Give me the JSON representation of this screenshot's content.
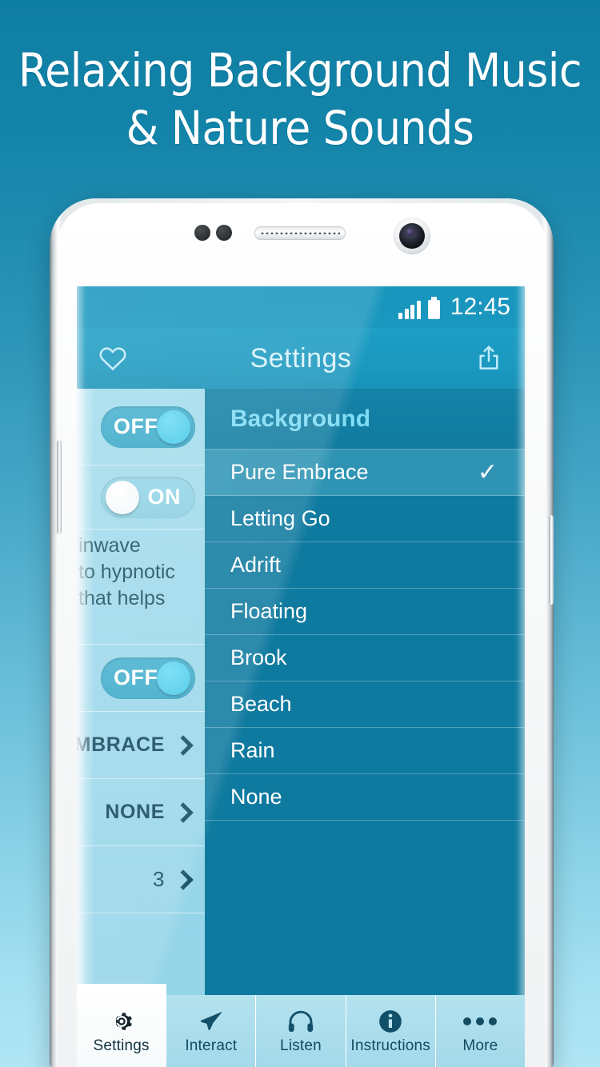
{
  "promo": {
    "headline_line1": "Relaxing Background Music",
    "headline_line2": "& Nature Sounds"
  },
  "statusbar": {
    "time": "12:45",
    "signal_icon": "signal-bars-icon",
    "battery_icon": "battery-full-icon"
  },
  "appbar": {
    "title": "Settings",
    "left_icon": "heart-icon",
    "right_icon": "share-icon"
  },
  "settings_panel": {
    "rows": [
      {
        "type": "toggle",
        "state": "OFF"
      },
      {
        "type": "toggle",
        "state": "ON"
      },
      {
        "type": "text",
        "lines": [
          "inwave",
          "to hypnotic",
          "that helps"
        ]
      },
      {
        "type": "toggle",
        "state": "OFF"
      },
      {
        "type": "value",
        "value": "MBRACE",
        "chevron": "chevron-right-icon"
      },
      {
        "type": "value",
        "value": "NONE",
        "chevron": "chevron-right-icon"
      },
      {
        "type": "value",
        "value": "3",
        "chevron": "chevron-right-icon"
      },
      {
        "type": "empty"
      }
    ]
  },
  "background_list": {
    "header": "Background",
    "selected": "Pure Embrace",
    "check_icon": "checkmark-icon",
    "items": [
      "Pure Embrace",
      "Letting Go",
      "Adrift",
      "Floating",
      "Brook",
      "Beach",
      "Rain",
      "None"
    ]
  },
  "tabbar": {
    "active": "Settings",
    "tabs": [
      {
        "label": "Settings",
        "icon": "gear-icon"
      },
      {
        "label": "Interact",
        "icon": "paper-plane-icon"
      },
      {
        "label": "Listen",
        "icon": "headphones-icon"
      },
      {
        "label": "Instructions",
        "icon": "info-circle-icon"
      },
      {
        "label": "More",
        "icon": "ellipsis-icon"
      }
    ]
  },
  "colors": {
    "bg_top": "#0f7ea4",
    "bg_bottom": "#b0e6f5",
    "appbar": "#1b99c0",
    "list_bg": "#0f7a9f",
    "list_selected": "#2f94b4",
    "list_header_text": "#7fdcf5",
    "left_panel": "#9ad7ea",
    "tab_inactive": "#a3d9ea",
    "tab_active": "#ffffff",
    "knob_on": "#ffffff",
    "knob_off": "#41c6e6"
  }
}
